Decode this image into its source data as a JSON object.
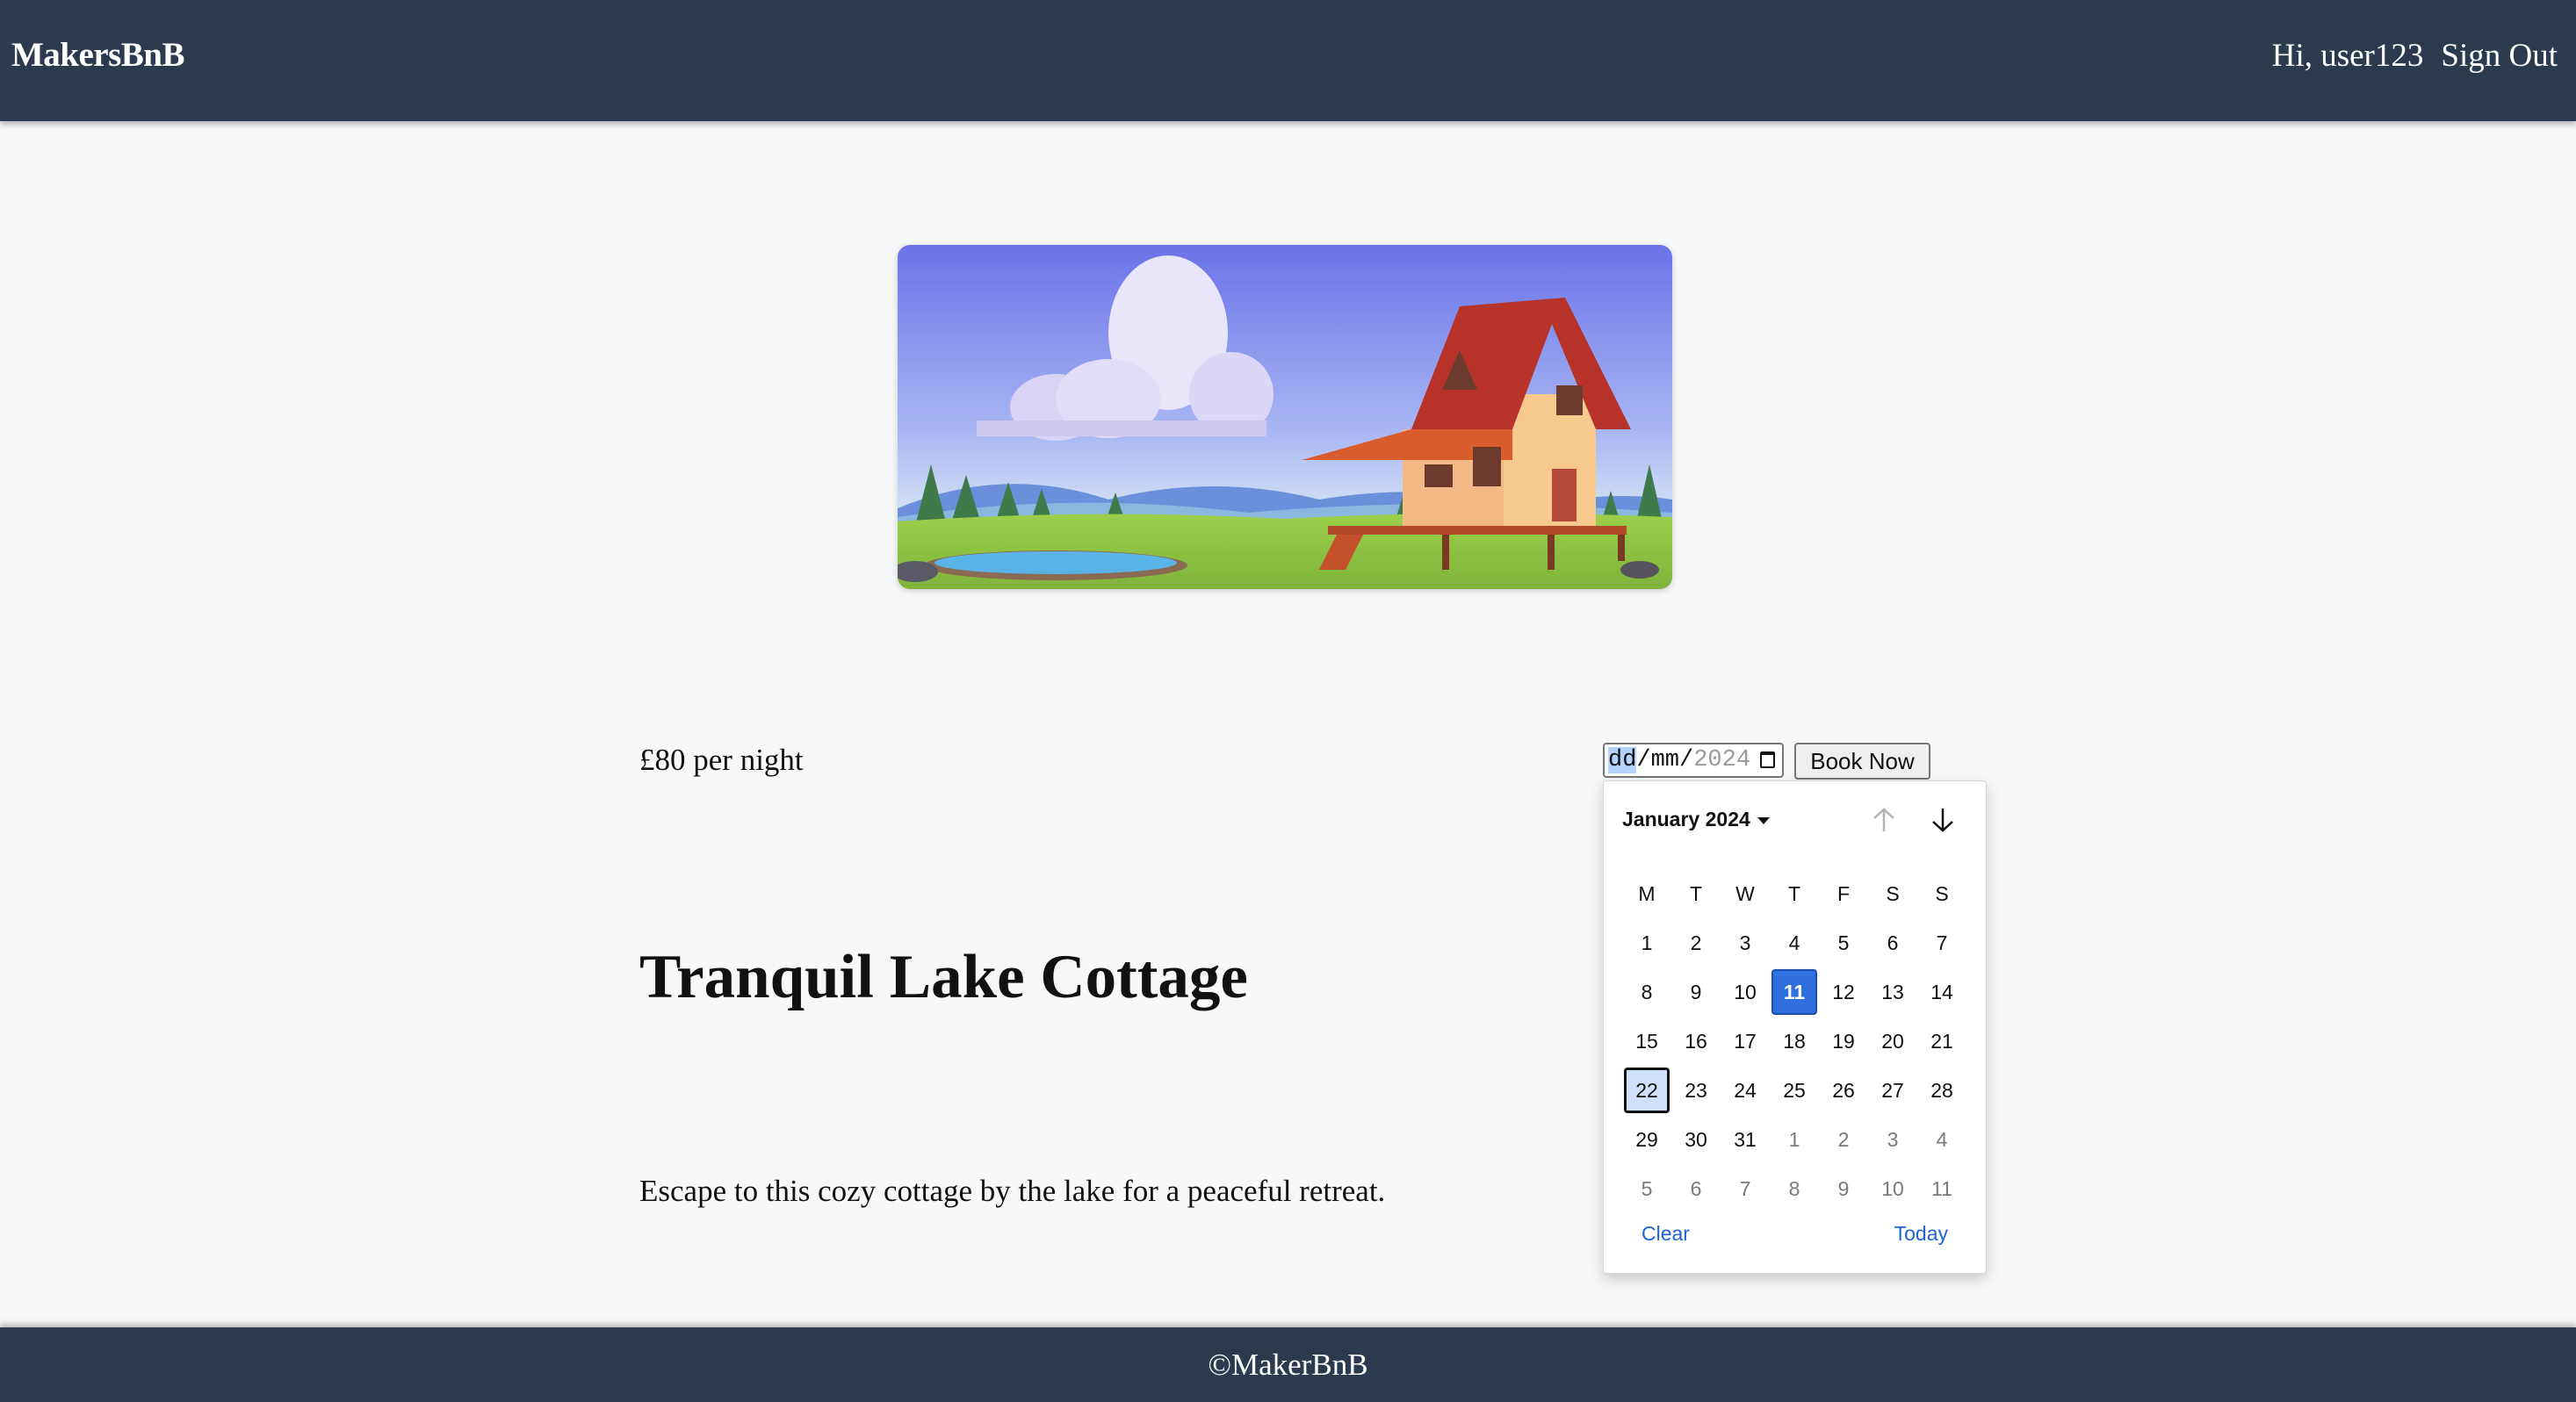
{
  "header": {
    "brand": "MakersBnB",
    "greeting": "Hi, user123",
    "sign_out": "Sign Out"
  },
  "listing": {
    "price": "£80 per night",
    "title": "Tranquil Lake Cottage",
    "description": "Escape to this cozy cottage by the lake for a peaceful retreat."
  },
  "booking": {
    "date_day": "dd",
    "date_sep1": "/",
    "date_month": "mm",
    "date_sep2": "/",
    "date_year": "2024",
    "book_button": "Book Now"
  },
  "calendar": {
    "month_label": "January 2024",
    "weekdays": [
      "M",
      "T",
      "W",
      "T",
      "F",
      "S",
      "S"
    ],
    "days": [
      {
        "d": "1"
      },
      {
        "d": "2"
      },
      {
        "d": "3"
      },
      {
        "d": "4"
      },
      {
        "d": "5"
      },
      {
        "d": "6"
      },
      {
        "d": "7"
      },
      {
        "d": "8"
      },
      {
        "d": "9"
      },
      {
        "d": "10"
      },
      {
        "d": "11",
        "state": "today"
      },
      {
        "d": "12"
      },
      {
        "d": "13"
      },
      {
        "d": "14"
      },
      {
        "d": "15"
      },
      {
        "d": "16"
      },
      {
        "d": "17"
      },
      {
        "d": "18"
      },
      {
        "d": "19"
      },
      {
        "d": "20"
      },
      {
        "d": "21"
      },
      {
        "d": "22",
        "state": "focused"
      },
      {
        "d": "23"
      },
      {
        "d": "24"
      },
      {
        "d": "25"
      },
      {
        "d": "26"
      },
      {
        "d": "27"
      },
      {
        "d": "28"
      },
      {
        "d": "29"
      },
      {
        "d": "30"
      },
      {
        "d": "31"
      },
      {
        "d": "1",
        "state": "other"
      },
      {
        "d": "2",
        "state": "other"
      },
      {
        "d": "3",
        "state": "other"
      },
      {
        "d": "4",
        "state": "other"
      },
      {
        "d": "5",
        "state": "other"
      },
      {
        "d": "6",
        "state": "other"
      },
      {
        "d": "7",
        "state": "other"
      },
      {
        "d": "8",
        "state": "other"
      },
      {
        "d": "9",
        "state": "other"
      },
      {
        "d": "10",
        "state": "other"
      },
      {
        "d": "11",
        "state": "other"
      }
    ],
    "clear_label": "Clear",
    "today_label": "Today",
    "prev_icon": "arrow-up-icon",
    "next_icon": "arrow-down-icon"
  },
  "footer": {
    "copyright": "©MakerBnB"
  },
  "colors": {
    "header_bg": "#2c3a4f",
    "accent_blue": "#2f6fde",
    "link_blue": "#1d63d6"
  }
}
